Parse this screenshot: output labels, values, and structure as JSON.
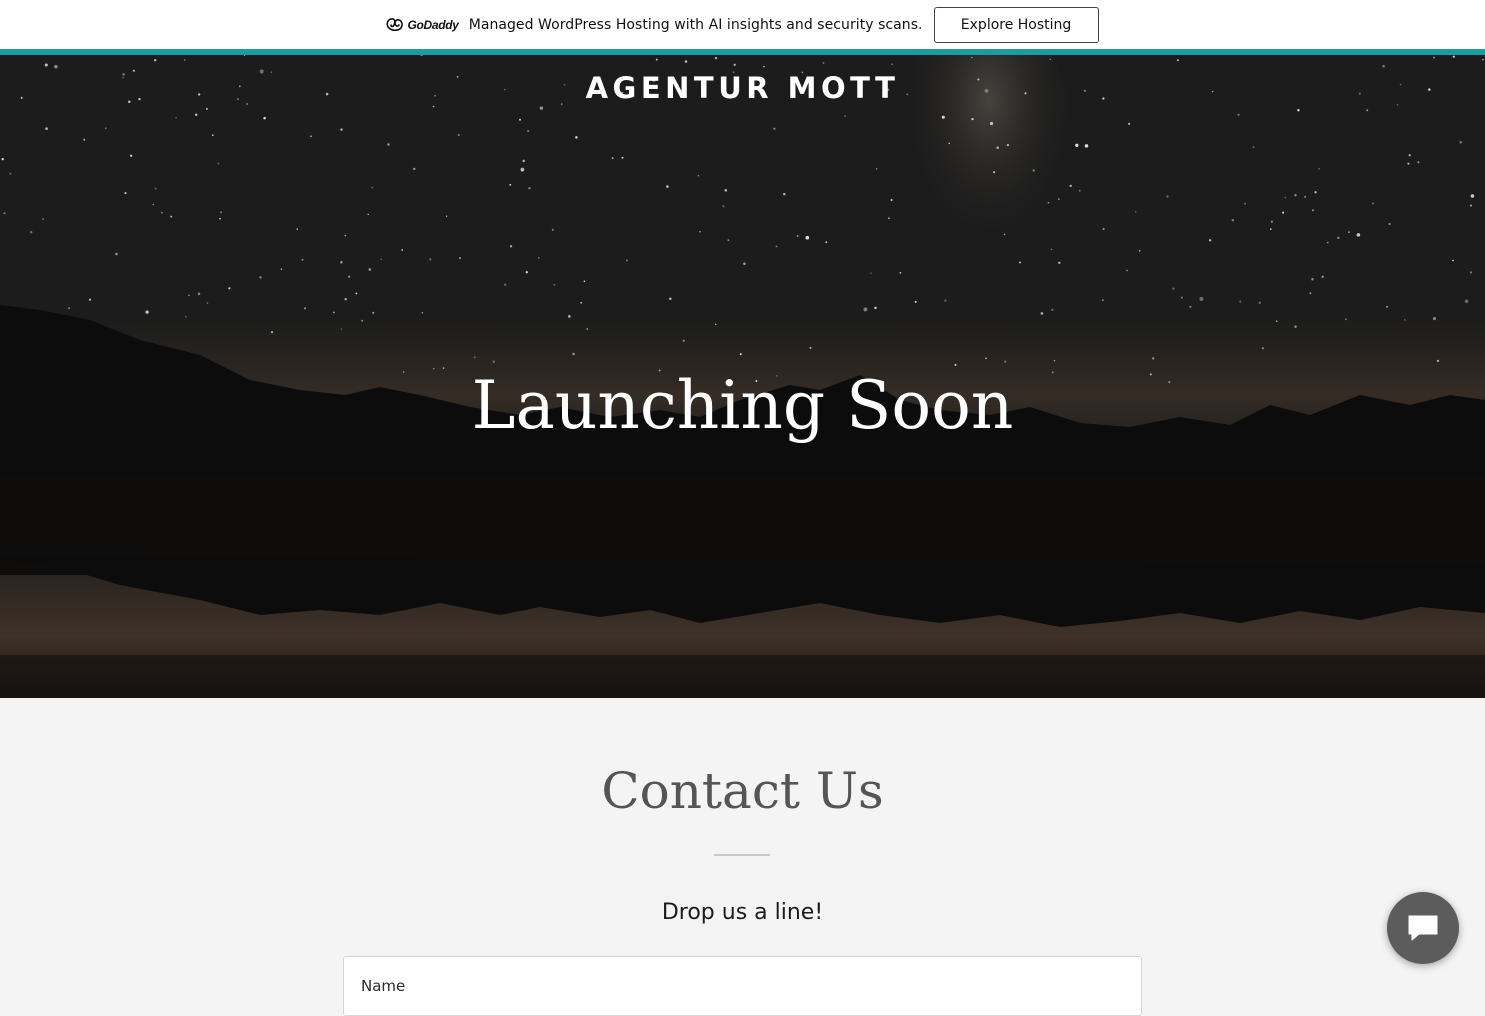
{
  "promo": {
    "logo_text": "GoDaddy",
    "message": "Managed WordPress Hosting with AI insights and security scans.",
    "button_label": "Explore Hosting",
    "stripe_color": "#1c9ba1"
  },
  "hero": {
    "site_title": "AGENTUR MOTT",
    "headline": "Launching Soon"
  },
  "contact": {
    "title": "Contact Us",
    "subtitle": "Drop us a line!",
    "name_label": "Name"
  },
  "chat": {
    "icon": "chat-bubble-icon"
  }
}
